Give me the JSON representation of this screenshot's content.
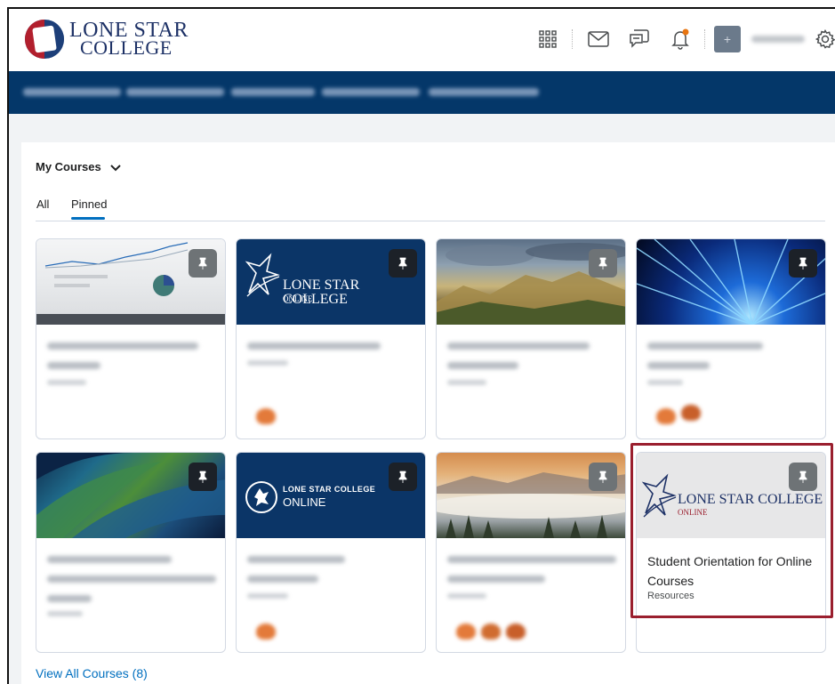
{
  "header": {
    "logo_line1": "LONE STAR",
    "logo_line2": "COLLEGE",
    "icons": [
      "app-grid-icon",
      "mail-icon",
      "chat-icon",
      "bell-icon",
      "gear-icon"
    ]
  },
  "widget": {
    "title": "My Courses",
    "tabs": [
      "All",
      "Pinned"
    ],
    "active_tab": "Pinned",
    "view_all": "View All Courses (8)"
  },
  "brand_text": {
    "lsc_online_name": "LONE STAR COLLEGE",
    "lsc_online_sub": "ONLINE",
    "lsc_online_small_name": "LONE STAR COLLEGE",
    "lsc_online_small_sub": "ONLINE",
    "lsc_online_light_name": "LONE STAR COLLEGE",
    "lsc_online_light_sub": "ONLINE"
  },
  "highlighted_course": {
    "title": "Student Orientation for Online Courses",
    "subtitle": "Resources"
  },
  "colors": {
    "navbar": "#043769",
    "link": "#006fbf",
    "highlight_border": "#9a1f2e",
    "notification_dot": "#e87511"
  }
}
